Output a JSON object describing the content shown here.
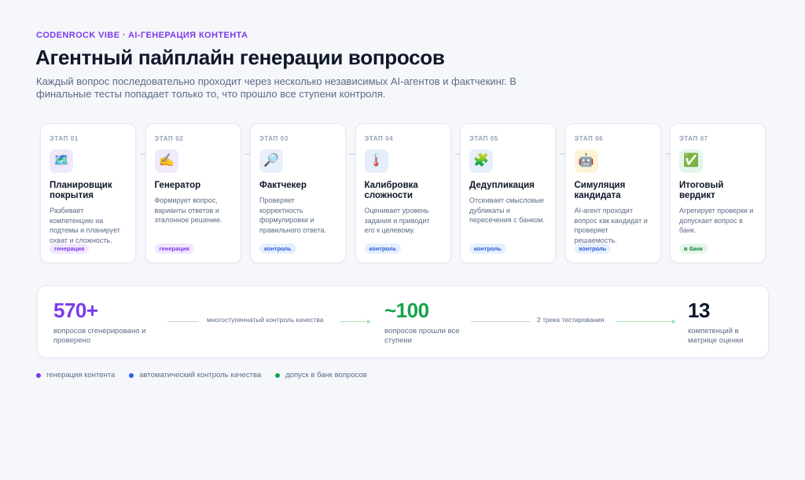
{
  "header": {
    "eyebrow": "CODENROCK VIBE · AI-ГЕНЕРАЦИЯ КОНТЕНТА",
    "title": "Агентный пайплайн генерации вопросов",
    "subtitle": "Каждый вопрос последовательно проходит через несколько независимых AI-агентов и фактчекинг. В финальные тесты попадает только то, что прошло все ступени контроля."
  },
  "stages": [
    {
      "number": "ЭТАП 01",
      "icon": "map-icon",
      "glyph": "🗺️",
      "title": "Планировщик покрытия",
      "description": "Разбивает компетенцию на подтемы и планирует охват и сложность.",
      "tag": "генерация",
      "tag_type": "gen"
    },
    {
      "number": "ЭТАП 02",
      "icon": "writing-hand-icon",
      "glyph": "✍️",
      "title": "Генератор",
      "description": "Формирует вопрос, варианты ответов и эталонное решение.",
      "tag": "генерация",
      "tag_type": "gen"
    },
    {
      "number": "ЭТАП 03",
      "icon": "magnifier-icon",
      "glyph": "🔎",
      "title": "Фактчекер",
      "description": "Проверяет корректность формулировки и правильного ответа.",
      "tag": "контроль",
      "tag_type": "ctl"
    },
    {
      "number": "ЭТАП 04",
      "icon": "thermometer-icon",
      "glyph": "🌡️",
      "title": "Калибровка сложности",
      "description": "Оценивает уровень задания и приводит его к целевому.",
      "tag": "контроль",
      "tag_type": "ctl"
    },
    {
      "number": "ЭТАП 05",
      "icon": "puzzle-icon",
      "glyph": "🧩",
      "title": "Дедупликация",
      "description": "Отсеивает смысловые дубликаты и пересечения с банком.",
      "tag": "контроль",
      "tag_type": "ctl"
    },
    {
      "number": "ЭТАП 06",
      "icon": "robot-icon",
      "glyph": "🤖",
      "title": "Симуляция кандидата",
      "description": "AI-агент проходит вопрос как кандидат и проверяет решаемость.",
      "tag": "контроль",
      "tag_type": "ctl"
    },
    {
      "number": "ЭТАП 07",
      "icon": "check-mark-icon",
      "glyph": "✅",
      "title": "Итоговый вердикт",
      "description": "Агрегирует проверки и допускает вопрос в банк.",
      "tag": "в банк",
      "tag_type": "ok"
    }
  ],
  "stats": [
    {
      "value": "570+",
      "label": "вопросов сгенерировано и проверено",
      "color": "#7c3aed"
    },
    {
      "value": "~100",
      "label": "вопросов прошли все ступени",
      "color": "#16a34a"
    },
    {
      "value": "13",
      "label": "компетенций в матрице оценки",
      "color": "#0f172a"
    }
  ],
  "flows": [
    {
      "label": "многоступенчатый контроль качества"
    },
    {
      "label": "2 трека тестирования"
    }
  ],
  "legend": [
    {
      "label": "генерация контента",
      "color": "#7c3aed"
    },
    {
      "label": "автоматический контроль качества",
      "color": "#2563eb"
    },
    {
      "label": "допуск в банк вопросов",
      "color": "#16a34a"
    }
  ],
  "colors": {
    "accent": "#7c3aed",
    "control": "#2563eb",
    "approved": "#16a34a"
  }
}
